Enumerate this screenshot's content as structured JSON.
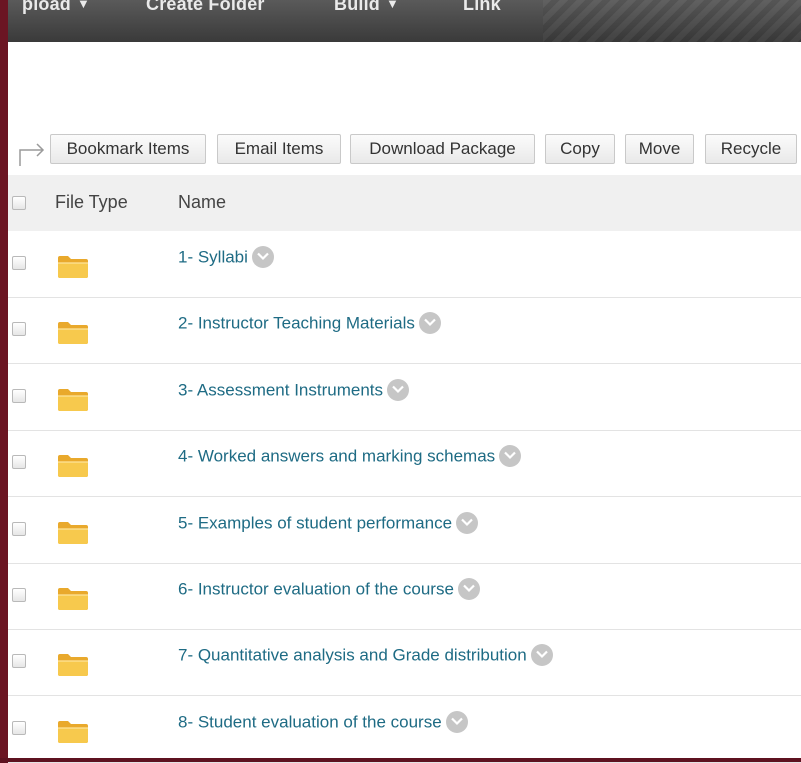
{
  "toolbar": {
    "items": [
      {
        "label": "pload",
        "has_dropdown": true
      },
      {
        "label": "Create Folder",
        "has_dropdown": false
      },
      {
        "label": "Build",
        "has_dropdown": true
      },
      {
        "label": "Link",
        "has_dropdown": false
      }
    ]
  },
  "actions": {
    "bookmark": "Bookmark Items",
    "email": "Email Items",
    "download": "Download Package",
    "copy": "Copy",
    "move": "Move",
    "recycle": "Recycle"
  },
  "table": {
    "headers": {
      "file_type": "File Type",
      "name": "Name"
    },
    "rows": [
      {
        "name": "1- Syllabi",
        "icon": "folder-icon"
      },
      {
        "name": "2- Instructor Teaching Materials",
        "icon": "folder-icon"
      },
      {
        "name": "3- Assessment Instruments",
        "icon": "folder-icon"
      },
      {
        "name": "4- Worked answers and marking schemas",
        "icon": "folder-icon"
      },
      {
        "name": "5- Examples of student performance",
        "icon": "folder-icon"
      },
      {
        "name": "6- Instructor evaluation of the course",
        "icon": "folder-icon"
      },
      {
        "name": "7- Quantitative analysis and Grade distribution",
        "icon": "folder-icon"
      },
      {
        "name": "8- Student evaluation of the course",
        "icon": "folder-icon"
      }
    ]
  },
  "colors": {
    "frame": "#5e1220",
    "toolbar": "#4a4a4a",
    "link": "#1e6b84",
    "folder": "#f5c242"
  }
}
